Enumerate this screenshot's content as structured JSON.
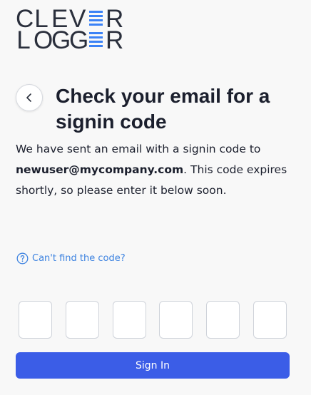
{
  "logo": {
    "row1": [
      "C",
      "L",
      "E",
      "V",
      "E",
      "R"
    ],
    "row2": [
      "L",
      "O",
      "G",
      "G",
      "E",
      "R"
    ],
    "accent_color": "#3b82f6",
    "text_color": "#2a2f3c"
  },
  "header": {
    "back_icon": "chevron-left-icon",
    "title": "Check your email for a signin code"
  },
  "message": {
    "part1": "We have sent an email with a signin code to ",
    "email": "newuser@mycompany.com",
    "part2": ". This code expires shortly, so please enter it below soon."
  },
  "help": {
    "icon": "question-circle-icon",
    "label": "Can't find the code?"
  },
  "code_inputs": [
    "",
    "",
    "",
    "",
    "",
    ""
  ],
  "sign_in": {
    "label": "Sign In",
    "color": "#3b5de7"
  }
}
